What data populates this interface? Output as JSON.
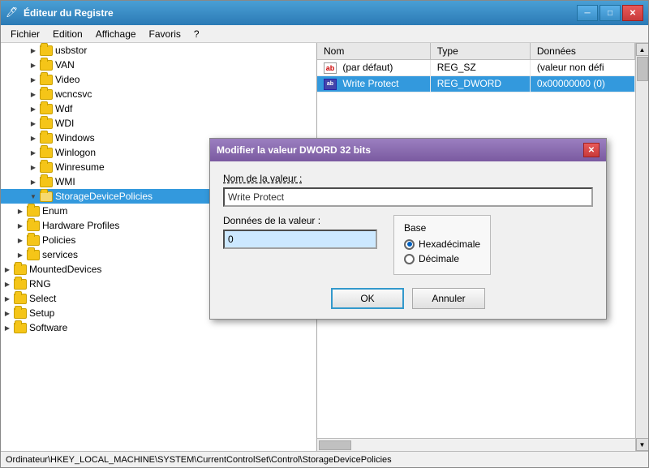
{
  "window": {
    "title": "Éditeur du Registre",
    "icon": "🖊"
  },
  "titlebar": {
    "minimize": "─",
    "maximize": "□",
    "close": "✕"
  },
  "menu": {
    "items": [
      "Fichier",
      "Edition",
      "Affichage",
      "Favoris",
      "?"
    ]
  },
  "tree": {
    "items": [
      {
        "label": "usbstor",
        "indent": 2,
        "expanded": false
      },
      {
        "label": "VAN",
        "indent": 2,
        "expanded": false
      },
      {
        "label": "Video",
        "indent": 2,
        "expanded": false
      },
      {
        "label": "wcncsvc",
        "indent": 2,
        "expanded": false
      },
      {
        "label": "Wdf",
        "indent": 2,
        "expanded": false
      },
      {
        "label": "WDI",
        "indent": 2,
        "expanded": false
      },
      {
        "label": "Windows",
        "indent": 2,
        "expanded": false
      },
      {
        "label": "Winlogon",
        "indent": 2,
        "expanded": false
      },
      {
        "label": "Winresume",
        "indent": 2,
        "expanded": false
      },
      {
        "label": "WMI",
        "indent": 2,
        "expanded": false
      },
      {
        "label": "StorageDevicePolicies",
        "indent": 2,
        "expanded": true,
        "selected": true
      },
      {
        "label": "Enum",
        "indent": 1,
        "expanded": false
      },
      {
        "label": "Hardware Profiles",
        "indent": 1,
        "expanded": false
      },
      {
        "label": "Policies",
        "indent": 1,
        "expanded": false
      },
      {
        "label": "services",
        "indent": 1,
        "expanded": false
      },
      {
        "label": "MountedDevices",
        "indent": 0,
        "expanded": false
      },
      {
        "label": "RNG",
        "indent": 0,
        "expanded": false
      },
      {
        "label": "Select",
        "indent": 0,
        "expanded": false
      },
      {
        "label": "Setup",
        "indent": 0,
        "expanded": false
      },
      {
        "label": "Software",
        "indent": 0,
        "expanded": false
      }
    ]
  },
  "registry_table": {
    "columns": [
      "Nom",
      "Type",
      "Données"
    ],
    "rows": [
      {
        "name": "(par défaut)",
        "type": "REG_SZ",
        "data": "(valeur non défi",
        "icon": "ab"
      },
      {
        "name": "Write Protect",
        "type": "REG_DWORD",
        "data": "0x00000000 (0)",
        "icon": "dword",
        "selected": true
      }
    ]
  },
  "dialog": {
    "title": "Modifier la valeur DWORD 32 bits",
    "name_label": "Nom de la valeur :",
    "name_value": "Write Protect",
    "data_label": "Données de la valeur :",
    "data_value": "0",
    "base_label": "Base",
    "base_options": [
      {
        "label": "Hexadécimale",
        "checked": true
      },
      {
        "label": "Décimale",
        "checked": false
      }
    ],
    "ok_label": "OK",
    "cancel_label": "Annuler",
    "close": "✕"
  },
  "statusbar": {
    "path": "Ordinateur\\HKEY_LOCAL_MACHINE\\SYSTEM\\CurrentControlSet\\Control\\StorageDevicePolicies"
  }
}
